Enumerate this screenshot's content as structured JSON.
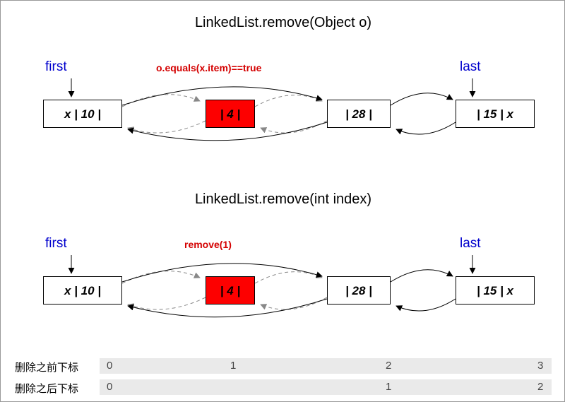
{
  "title1": "LinkedList.remove(Object o)",
  "title2": "LinkedList.remove(int index)",
  "firstLabel": "first",
  "lastLabel": "last",
  "cond1": "o.equals(x.item)==true",
  "cond2": "remove(1)",
  "nodes": {
    "first": "x | 10 |",
    "removed": "| 4 |",
    "third": "| 28 |",
    "last": "| 15 | x"
  },
  "indexBeforeTitle": "删除之前下标",
  "indexAfterTitle": "删除之后下标",
  "indexBefore": [
    "0",
    "1",
    "2",
    "3"
  ],
  "indexAfter": [
    "0",
    "",
    "1",
    "2"
  ]
}
